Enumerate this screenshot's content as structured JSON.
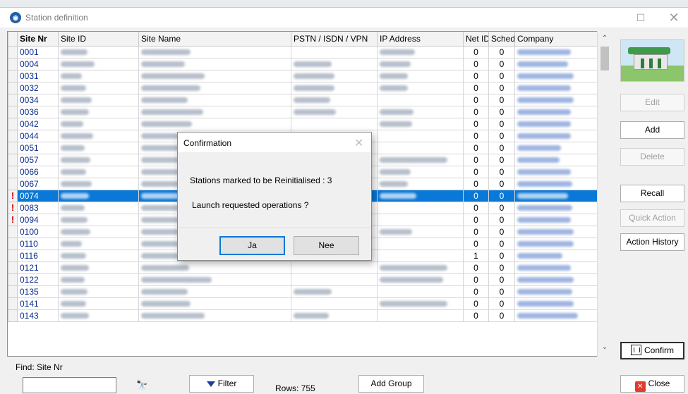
{
  "window": {
    "title": "Station definition"
  },
  "columns": [
    "Site Nr",
    "Site ID",
    "Site Name",
    "PSTN / ISDN / VPN",
    "IP Address",
    "Net ID",
    "Sched",
    "Company"
  ],
  "rows": [
    {
      "site_nr": "0001",
      "flag": "",
      "net_id": "0",
      "sched": "0"
    },
    {
      "site_nr": "0004",
      "flag": "",
      "net_id": "0",
      "sched": "0"
    },
    {
      "site_nr": "0031",
      "flag": "",
      "net_id": "0",
      "sched": "0"
    },
    {
      "site_nr": "0032",
      "flag": "",
      "net_id": "0",
      "sched": "0"
    },
    {
      "site_nr": "0034",
      "flag": "",
      "net_id": "0",
      "sched": "0"
    },
    {
      "site_nr": "0036",
      "flag": "",
      "net_id": "0",
      "sched": "0"
    },
    {
      "site_nr": "0042",
      "flag": "",
      "net_id": "0",
      "sched": "0"
    },
    {
      "site_nr": "0044",
      "flag": "",
      "net_id": "0",
      "sched": "0"
    },
    {
      "site_nr": "0051",
      "flag": "",
      "net_id": "0",
      "sched": "0"
    },
    {
      "site_nr": "0057",
      "flag": "",
      "net_id": "0",
      "sched": "0"
    },
    {
      "site_nr": "0066",
      "flag": "",
      "net_id": "0",
      "sched": "0"
    },
    {
      "site_nr": "0067",
      "flag": "",
      "net_id": "0",
      "sched": "0"
    },
    {
      "site_nr": "0074",
      "flag": "!",
      "net_id": "0",
      "sched": "0",
      "selected": true
    },
    {
      "site_nr": "0083",
      "flag": "!",
      "net_id": "0",
      "sched": "0"
    },
    {
      "site_nr": "0094",
      "flag": "!",
      "net_id": "0",
      "sched": "0"
    },
    {
      "site_nr": "0100",
      "flag": "",
      "net_id": "0",
      "sched": "0"
    },
    {
      "site_nr": "0110",
      "flag": "",
      "net_id": "0",
      "sched": "0"
    },
    {
      "site_nr": "0116",
      "flag": "",
      "net_id": "1",
      "sched": "0"
    },
    {
      "site_nr": "0121",
      "flag": "",
      "net_id": "0",
      "sched": "0"
    },
    {
      "site_nr": "0122",
      "flag": "",
      "net_id": "0",
      "sched": "0"
    },
    {
      "site_nr": "0135",
      "flag": "",
      "net_id": "0",
      "sched": "0"
    },
    {
      "site_nr": "0141",
      "flag": "",
      "net_id": "0",
      "sched": "0"
    },
    {
      "site_nr": "0143",
      "flag": "",
      "net_id": "0",
      "sched": "0"
    }
  ],
  "side_buttons": {
    "edit": "Edit",
    "add": "Add",
    "delete": "Delete",
    "recall": "Recall",
    "quick_action": "Quick Action",
    "action_history": "Action History",
    "confirm": "Confirm",
    "close": "Close"
  },
  "bottom": {
    "find_label": "Find: Site Nr",
    "find_value": "",
    "filter_label": "Filter",
    "rows_label": "Rows: 755",
    "add_group_label": "Add Group"
  },
  "dialog": {
    "title": "Confirmation",
    "message1": "Stations marked to be Reinitialised :  3",
    "message2": "Launch requested operations ?",
    "yes_label": "Ja",
    "no_label": "Nee"
  },
  "icons": {
    "app": "station-app-icon",
    "filter": "funnel-icon",
    "find": "binoculars-icon",
    "confirm": "trash-icon",
    "close": "red-close-icon"
  },
  "colors": {
    "selection": "#0a78d7",
    "site_nr_text": "#0a2d8c",
    "flag": "#cc0000"
  }
}
